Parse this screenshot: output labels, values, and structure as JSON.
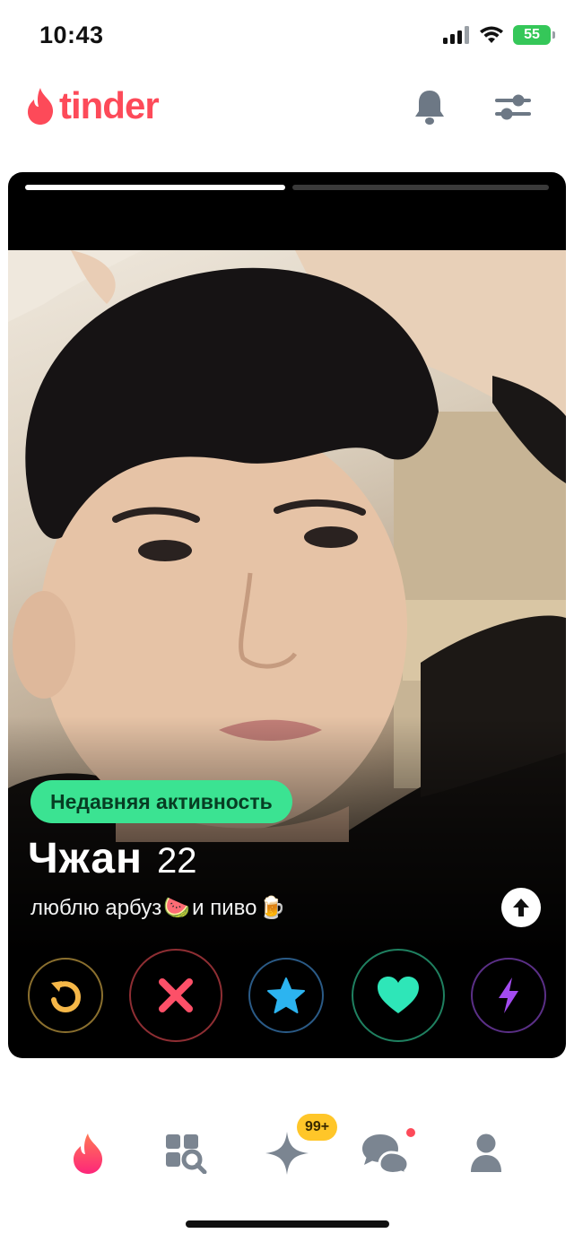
{
  "status_bar": {
    "time": "10:43",
    "battery": "55",
    "icons": [
      "signal-icon",
      "wifi-icon",
      "battery-icon"
    ]
  },
  "header": {
    "logo_text": "tinder",
    "icons": [
      "flame-icon",
      "bell-icon",
      "filter-sliders-icon"
    ],
    "brand_color": "#fd4a59"
  },
  "card": {
    "photo_count": 2,
    "current_photo": 1,
    "activity_badge": "Недавняя активность",
    "name": "Чжан",
    "age": "22",
    "bio": {
      "part1": "люблю арбуз",
      "emoji1": "🍉",
      "part2": " и пиво",
      "emoji2": "🍺"
    },
    "info_icon": "arrow-up-icon"
  },
  "actions": [
    {
      "name": "rewind",
      "icon": "rewind-icon",
      "color": "#f5b748"
    },
    {
      "name": "nope",
      "icon": "close-icon",
      "color": "#fd5068"
    },
    {
      "name": "super-like",
      "icon": "star-icon",
      "color": "#2cb4f0"
    },
    {
      "name": "like",
      "icon": "heart-icon",
      "color": "#2ee6b8"
    },
    {
      "name": "boost",
      "icon": "bolt-icon",
      "color": "#a34bf0"
    }
  ],
  "bottom_nav": {
    "items": [
      "flame-icon",
      "explore-grid-icon",
      "sparkle-icon",
      "chat-bubbles-icon",
      "person-icon"
    ],
    "active": "flame-icon",
    "top_picks_badge": "99+",
    "badge_color": "#ffc629"
  }
}
